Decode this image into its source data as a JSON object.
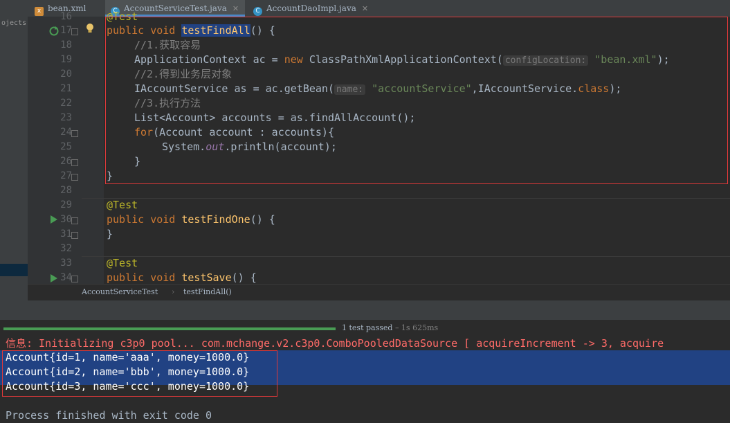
{
  "tabs": [
    {
      "label": "bean.xml",
      "icon": "xml-file-icon"
    },
    {
      "label": "AccountServiceTest.java",
      "icon": "java-class-icon",
      "active": true
    },
    {
      "label": "AccountDaoImpl.java",
      "icon": "java-class-icon"
    }
  ],
  "project_panel": {
    "label": "ojects"
  },
  "editor": {
    "line_numbers": [
      "16",
      "17",
      "18",
      "19",
      "20",
      "21",
      "22",
      "23",
      "24",
      "25",
      "26",
      "27",
      "28",
      "29",
      "30",
      "31",
      "32",
      "33",
      "34"
    ],
    "lines": {
      "l16": "@Test",
      "l17_kw": "public void ",
      "l17_fn": "testFindAll",
      "l17_rest": "() {",
      "l18": "//1.获取容易",
      "l19_a": "ApplicationContext ac = ",
      "l19_new": "new ",
      "l19_b": "ClassPathXmlApplicationContext(",
      "l19_hint": "configLocation:",
      "l19_str": "\"bean.xml\"",
      "l19_end": ");",
      "l20": "//2.得到业务层对象",
      "l21_a": "IAccountService as = ac.getBean(",
      "l21_hint": "name:",
      "l21_str": "\"accountService\"",
      "l21_b": ",IAccountService.",
      "l21_cls": "class",
      "l21_end": ");",
      "l22": "//3.执行方法",
      "l23": "List<Account> accounts = as.findAllAccount();",
      "l24_kw": "for",
      "l24_rest": "(Account account : accounts){",
      "l25_a": "System.",
      "l25_out": "out",
      "l25_b": ".println(account);",
      "l26": "}",
      "l27": "}",
      "l29": "@Test",
      "l30_kw": "public void ",
      "l30_fn": "testFindOne",
      "l30_rest": "() {",
      "l31": "}",
      "l33": "@Test",
      "l34_kw": "public void ",
      "l34_fn": "testSave",
      "l34_rest": "() {"
    }
  },
  "breadcrumb": {
    "class": "AccountServiceTest",
    "method": "testFindAll()"
  },
  "run": {
    "progress": 1.0,
    "status": "1 test passed",
    "time": "– 1s 625ms"
  },
  "console": {
    "log_line": "信息: Initializing c3p0 pool... com.mchange.v2.c3p0.ComboPooledDataSource [ acquireIncrement -> 3, acquire",
    "output": [
      "Account{id=1, name='aaa', money=1000.0}",
      "Account{id=2, name='bbb', money=1000.0}",
      "Account{id=3, name='ccc', money=1000.0}"
    ],
    "finished": "Process finished with exit code 0"
  }
}
